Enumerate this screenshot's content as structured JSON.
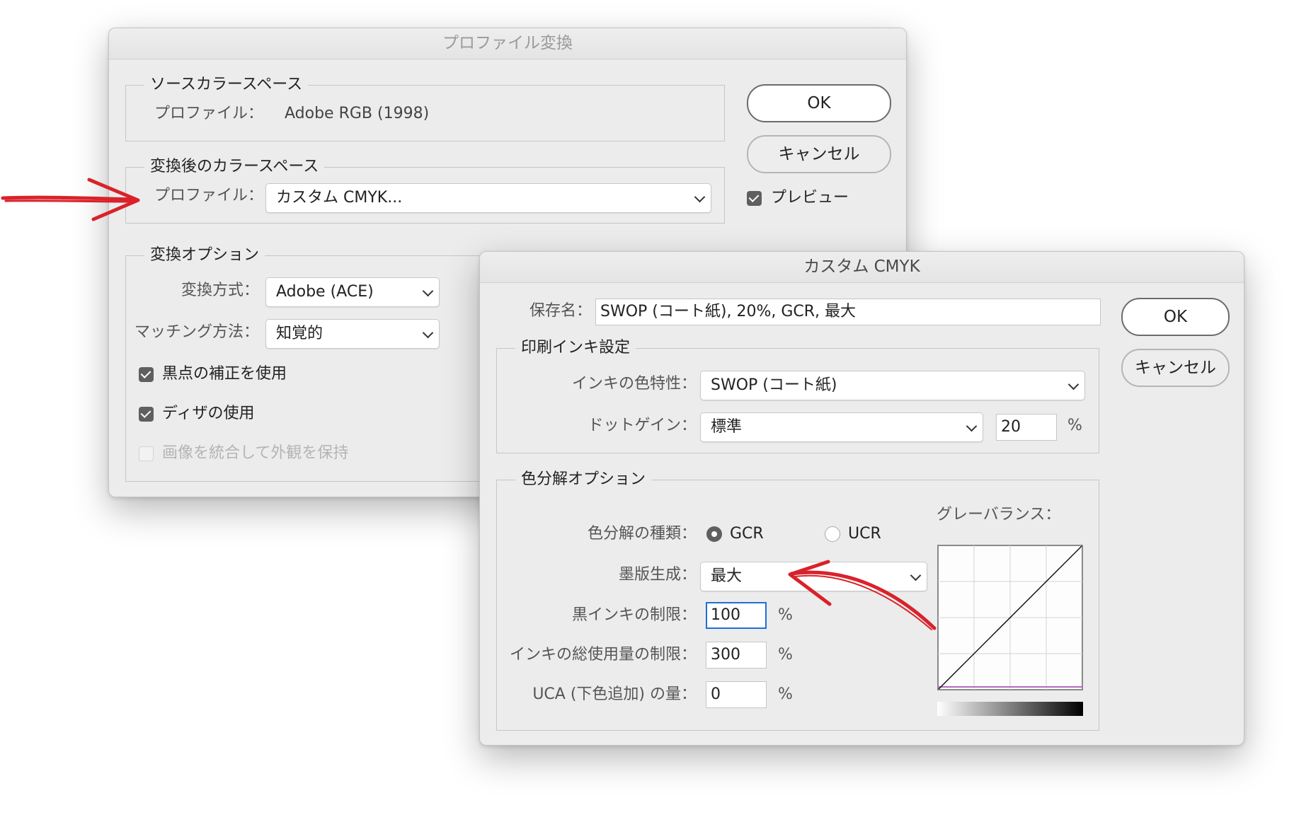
{
  "dialog1": {
    "title": "プロファイル変換",
    "source": {
      "legend": "ソースカラースペース",
      "profile_label": "プロファイル：",
      "profile_value": "Adobe RGB (1998)"
    },
    "dest": {
      "legend": "変換後のカラースペース",
      "profile_label": "プロファイル：",
      "profile_value": "カスタム CMYK..."
    },
    "options": {
      "legend": "変換オプション",
      "method_label": "変換方式：",
      "method_value": "Adobe (ACE)",
      "intent_label": "マッチング方法：",
      "intent_value": "知覚的",
      "bpc_label": "黒点の補正を使用",
      "bpc_checked": true,
      "dither_label": "ディザの使用",
      "dither_checked": true,
      "flatten_label": "画像を統合して外観を保持",
      "flatten_checked": false
    },
    "ok_label": "OK",
    "cancel_label": "キャンセル",
    "preview_label": "プレビュー",
    "preview_checked": true
  },
  "dialog2": {
    "title": "カスタム CMYK",
    "name_label": "保存名：",
    "name_value": "SWOP (コート紙), 20%, GCR, 最大",
    "ink": {
      "legend": "印刷インキ設定",
      "colors_label": "インキの色特性：",
      "colors_value": "SWOP (コート紙)",
      "dotgain_label": "ドットゲイン：",
      "dotgain_value": "標準",
      "dotgain_amount": "20",
      "dotgain_unit": "%"
    },
    "sep": {
      "legend": "色分解オプション",
      "type_label": "色分解の種類：",
      "gcr_label": "GCR",
      "ucr_label": "UCR",
      "selected_type": "GCR",
      "blackgen_label": "墨版生成：",
      "blackgen_value": "最大",
      "blacklimit_label": "黒インキの制限：",
      "blacklimit_value": "100",
      "totallimit_label": "インキの総使用量の制限：",
      "totallimit_value": "300",
      "uca_label": "UCA (下色追加) の量：",
      "uca_value": "0",
      "percent": "%",
      "graybalance_label": "グレーバランス："
    },
    "ok_label": "OK",
    "cancel_label": "キャンセル"
  },
  "annotation_color": "#d9222a"
}
